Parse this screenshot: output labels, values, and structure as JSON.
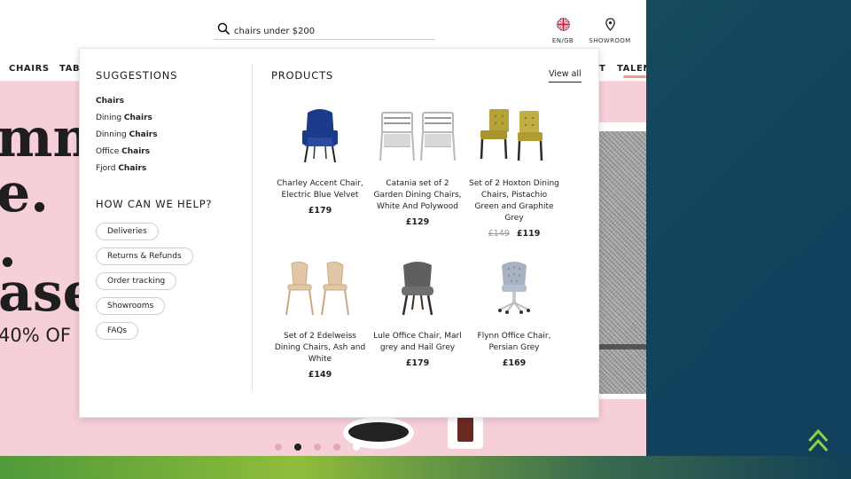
{
  "header": {
    "search_value": "chairs under $200",
    "language_label": "EN/GB",
    "showroom_label": "SHOWROOM"
  },
  "nav": {
    "items": [
      "CHAIRS",
      "TABL",
      "T",
      "TALEN"
    ]
  },
  "hero": {
    "line1": "mm",
    "line2": "e.",
    "line3": ".",
    "line4": "ase",
    "sub": "40% OF"
  },
  "dropdown": {
    "suggestions_title": "SUGGESTIONS",
    "suggestions": [
      {
        "prefix": "",
        "bold": "Chairs"
      },
      {
        "prefix": "Dining ",
        "bold": "Chairs"
      },
      {
        "prefix": "Dinning ",
        "bold": "Chairs"
      },
      {
        "prefix": "Office ",
        "bold": "Chairs"
      },
      {
        "prefix": "Fjord ",
        "bold": "Chairs"
      }
    ],
    "help_title": "HOW CAN WE HELP?",
    "help_links": [
      "Deliveries",
      "Returns & Refunds",
      "Order tracking",
      "Showrooms",
      "FAQs"
    ],
    "products_title": "PRODUCTS",
    "view_all": "View all",
    "products": [
      {
        "name": "Charley Accent Chair, Electric Blue Velvet",
        "price": "£179",
        "old_price": "",
        "image": "blue-velvet-chair-icon"
      },
      {
        "name": "Catania set of 2 Garden Dining Chairs, White And Polywood",
        "price": "£129",
        "old_price": "",
        "image": "garden-chairs-icon"
      },
      {
        "name": "Set of 2 Hoxton Dining Chairs, Pistachio Green and Graphite Grey",
        "price": "£119",
        "old_price": "£149",
        "image": "green-chairs-icon"
      },
      {
        "name": "Set of 2 Edelweiss Dining Chairs, Ash and White",
        "price": "£149",
        "old_price": "",
        "image": "ash-chairs-icon"
      },
      {
        "name": "Lule Office Chair, Marl grey and Hail Grey",
        "price": "£179",
        "old_price": "",
        "image": "grey-office-chair-icon"
      },
      {
        "name": "Flynn Office Chair, Persian Grey",
        "price": "£169",
        "old_price": "",
        "image": "tufted-office-chair-icon"
      }
    ]
  },
  "carousel": {
    "count": 5,
    "active_index": 1
  },
  "colors": {
    "hero_bg": "#f7cfd9",
    "accent_underline": "#f49b87",
    "scroll_top": "#8fd13f"
  }
}
